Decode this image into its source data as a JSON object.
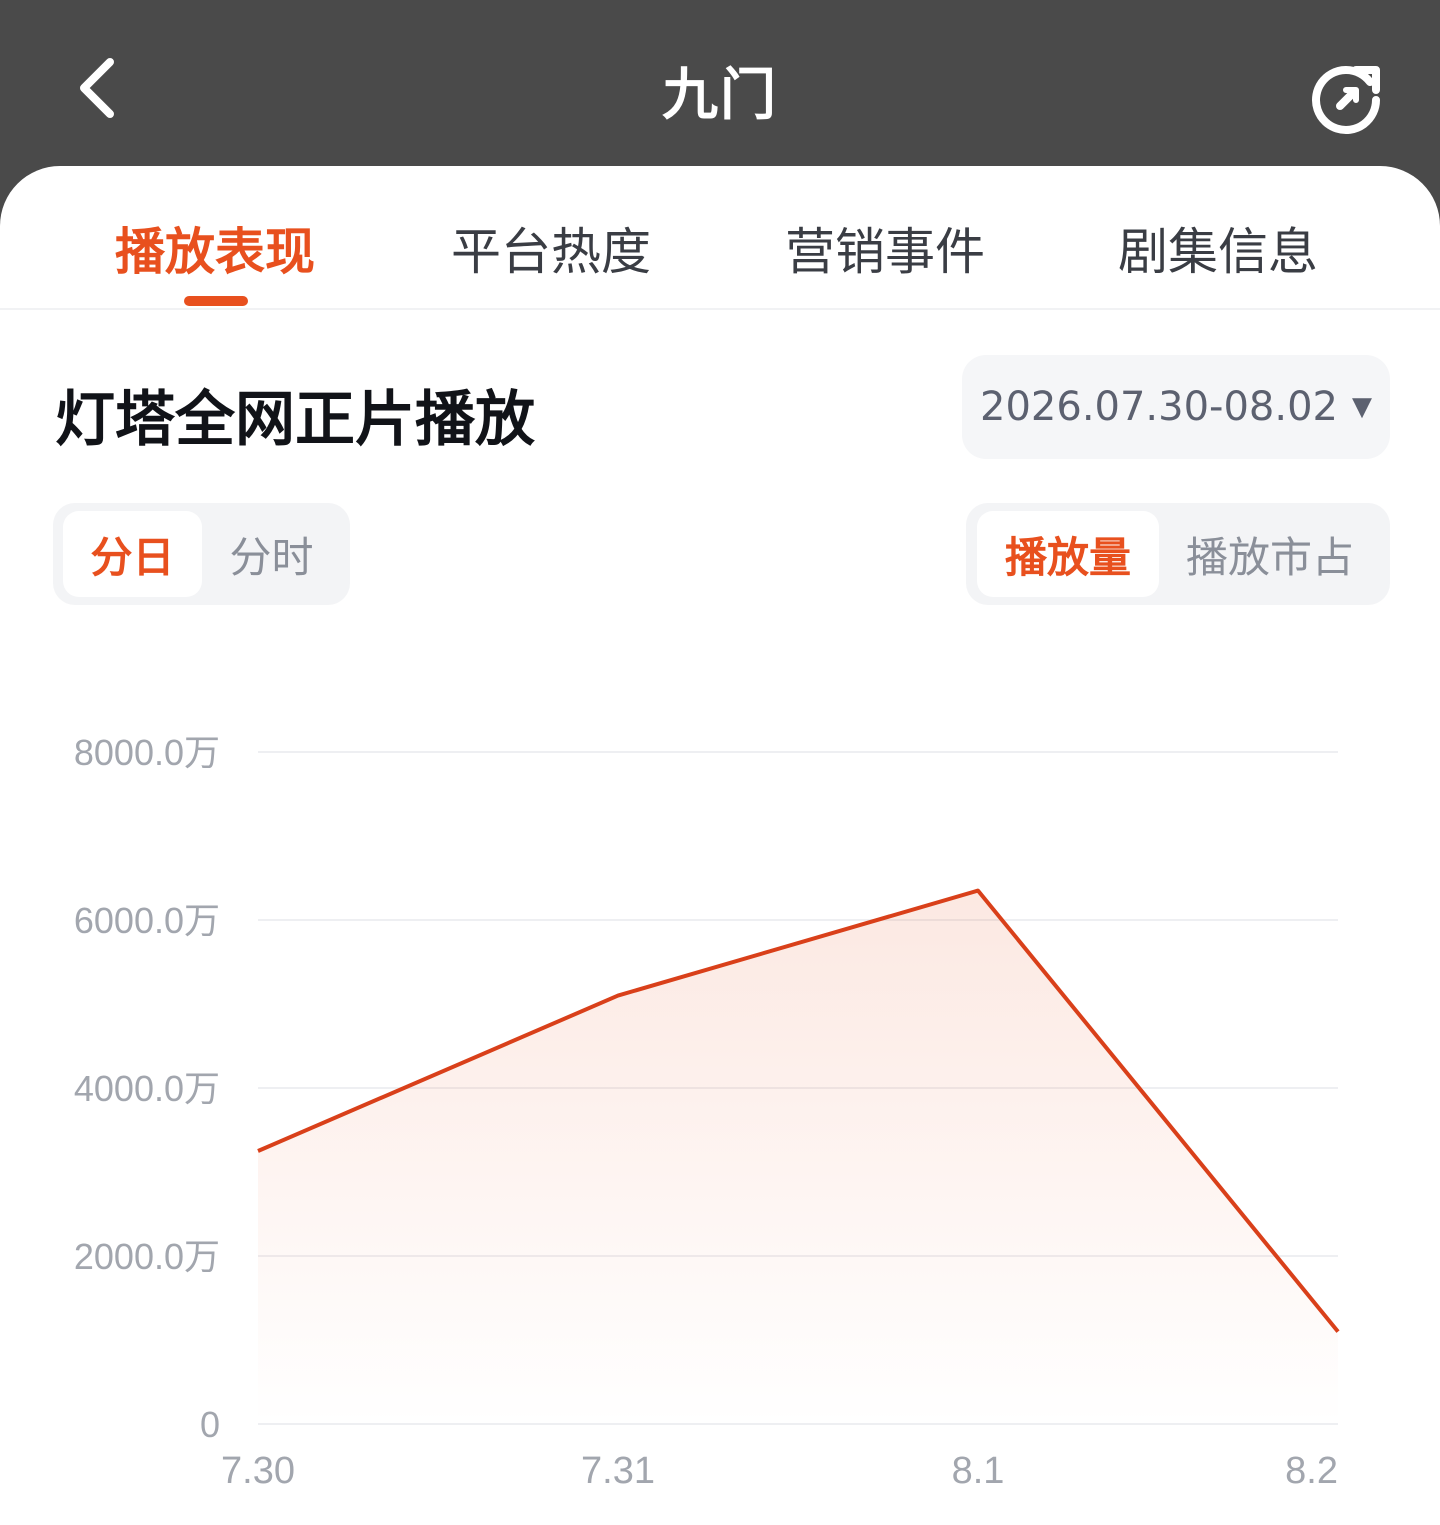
{
  "header": {
    "title": "九门",
    "back_icon": "chevron-left-icon",
    "refresh_icon": "refresh-icon"
  },
  "tabs": [
    {
      "label": "播放表现",
      "active": true
    },
    {
      "label": "平台热度",
      "active": false
    },
    {
      "label": "营销事件",
      "active": false
    },
    {
      "label": "剧集信息",
      "active": false
    }
  ],
  "section": {
    "title": "灯塔全网正片播放",
    "date_range": "2026.07.30-08.02",
    "date_caret": "▼"
  },
  "granularity_toggle": [
    {
      "label": "分日",
      "active": true
    },
    {
      "label": "分时",
      "active": false
    }
  ],
  "metric_toggle": [
    {
      "label": "播放量",
      "active": true
    },
    {
      "label": "播放市占",
      "active": false
    }
  ],
  "colors": {
    "accent": "#e8501e",
    "header_bg": "#4a4a4a",
    "line": "#d9401a"
  },
  "chart_data": {
    "type": "area",
    "title": "",
    "xlabel": "",
    "ylabel": "",
    "categories": [
      "7.30",
      "7.31",
      "8.1",
      "8.2"
    ],
    "series": [
      {
        "values": [
          3250,
          5100,
          6350,
          1100
        ]
      }
    ],
    "yticks": [
      0,
      2000,
      4000,
      6000,
      8000
    ],
    "ytick_labels": [
      "0",
      "2000.0万",
      "4000.0万",
      "6000.0万",
      "8000.0万"
    ],
    "ylim": [
      0,
      8000
    ],
    "unit": "万",
    "grid": true,
    "legend": "none"
  }
}
